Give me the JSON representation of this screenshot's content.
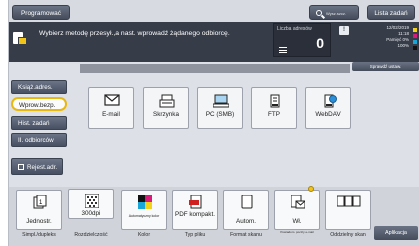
{
  "topbar": {
    "program_label": "Programować",
    "search_label": "Wysz.szcz.",
    "jobs_label": "Lista zadań"
  },
  "message": {
    "text": "Wybierz metodę przesył.,a nast. wprowadź żądanego odbiorcę.",
    "address_count_label": "Liczba adresów",
    "address_count": "0"
  },
  "status": {
    "date": "12/02/2019",
    "time": "11:18",
    "memory_label": "Pamięć",
    "memory_value": "0%",
    "toner_label": "100%",
    "toner_colors": [
      "#f2d21b",
      "#d81b7a",
      "#18a6d9",
      "#111111"
    ]
  },
  "recipient_settings_label": "Sprawdź ustaw.",
  "nav": {
    "items": [
      {
        "label": "Książ.adres."
      },
      {
        "label": "Wprow.bezp."
      },
      {
        "label": "Hist. zadań"
      },
      {
        "label": "II. odbiorców"
      }
    ],
    "register_label": "Rejest.adr."
  },
  "destinations": [
    {
      "label": "E-mail",
      "icon": "email-icon"
    },
    {
      "label": "Skrzynka",
      "icon": "box-icon"
    },
    {
      "label": "PC (SMB)",
      "icon": "pc-icon"
    },
    {
      "label": "FTP",
      "icon": "ftp-icon"
    },
    {
      "label": "WebDAV",
      "icon": "webdav-icon"
    }
  ],
  "settings": [
    {
      "value": "Jednostr.",
      "caption": "Simpl./dupleks",
      "icon": "duplex-icon"
    },
    {
      "value": "300dpi",
      "caption": "Rozdzielczość",
      "icon": "resolution-icon"
    },
    {
      "value": "Automatyczny kolor",
      "caption": "Kolor",
      "icon": "color-icon"
    },
    {
      "value": "PDF kompakt.",
      "caption": "Typ pliku",
      "icon": "file-type-icon"
    },
    {
      "value": "Autom.",
      "caption": "Format skanu",
      "icon": "scan-size-icon"
    },
    {
      "value": "Wł.",
      "caption": "Powiadom. poczty e-mail",
      "icon": "email-notify-icon"
    },
    {
      "value": "",
      "caption": "Oddzielny skan",
      "icon": "separate-scan-icon"
    }
  ],
  "apply_label": "Aplikacja"
}
